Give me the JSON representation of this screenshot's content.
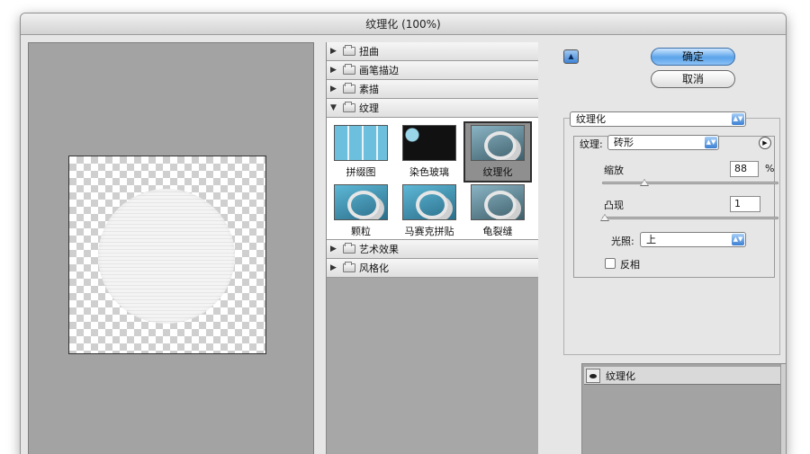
{
  "window": {
    "title": "纹理化 (100%)"
  },
  "filters": {
    "categories_top": [
      {
        "label": "扭曲",
        "expanded": false
      },
      {
        "label": "画笔描边",
        "expanded": false
      },
      {
        "label": "素描",
        "expanded": false
      },
      {
        "label": "纹理",
        "expanded": true
      }
    ],
    "texture_items": [
      {
        "label": "拼缀图",
        "icon": "patchwork-thumbnail"
      },
      {
        "label": "染色玻璃",
        "icon": "stained-glass-thumbnail"
      },
      {
        "label": "纹理化",
        "icon": "texturizer-thumbnail",
        "selected": true
      },
      {
        "label": "颗粒",
        "icon": "grain-thumbnail"
      },
      {
        "label": "马赛克拼贴",
        "icon": "mosaic-tiles-thumbnail"
      },
      {
        "label": "龟裂缝",
        "icon": "craquelure-thumbnail"
      }
    ],
    "categories_bottom": [
      {
        "label": "艺术效果",
        "expanded": false
      },
      {
        "label": "风格化",
        "expanded": false
      }
    ]
  },
  "buttons": {
    "ok": "确定",
    "cancel": "取消"
  },
  "controls": {
    "filter_select": "纹理化",
    "texture_label": "纹理:",
    "texture_value": "砖形",
    "scaling_label": "缩放",
    "scaling_value": "88",
    "scaling_unit": "%",
    "scaling_fraction": 0.22,
    "relief_label": "凸现",
    "relief_value": "1",
    "relief_fraction": 0.02,
    "light_label": "光照:",
    "light_value": "上",
    "invert_label": "反相",
    "invert_checked": false
  },
  "layers": {
    "items": [
      {
        "label": "纹理化",
        "visible": true
      }
    ]
  },
  "colors": {
    "accent_blue": "#5aa3ea",
    "panel_grey": "#a3a3a3"
  }
}
